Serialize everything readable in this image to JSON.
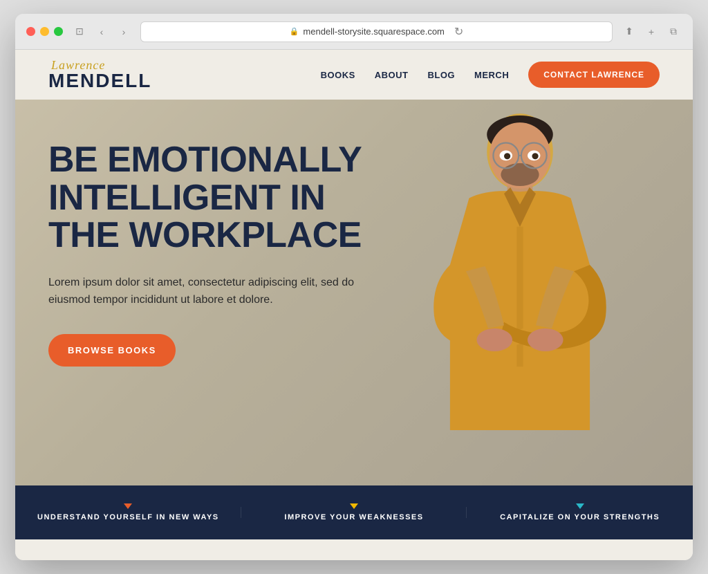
{
  "browser": {
    "url": "mendell-storysite.squarespace.com",
    "reload_icon": "↻",
    "back_icon": "‹",
    "forward_icon": "›",
    "share_icon": "⬆",
    "add_tab_icon": "+",
    "tabs_icon": "⧉",
    "window_icon": "⊡"
  },
  "navbar": {
    "logo_script": "Lawrence",
    "logo_main": "MENDELL",
    "nav_items": [
      {
        "label": "BOOKS",
        "id": "books"
      },
      {
        "label": "ABOUT",
        "id": "about"
      },
      {
        "label": "BLOG",
        "id": "blog"
      },
      {
        "label": "MERCH",
        "id": "merch"
      }
    ],
    "contact_button": "CONTACT LAWRENCE"
  },
  "hero": {
    "headline_line1": "BE EMOTIONALLY",
    "headline_line2": "INTELLIGENT IN",
    "headline_line3": "THE WORKPLACE",
    "subtext": "Lorem ipsum dolor sit amet, consectetur adipiscing elit, sed do eiusmod tempor incididunt ut labore et dolore.",
    "cta_button": "BROWSE BOOKS"
  },
  "bottom_bar": {
    "items": [
      {
        "label": "UNDERSTAND YOURSELF IN NEW WAYS",
        "arrow_color": "orange"
      },
      {
        "label": "IMPROVE YOUR WEAKNESSES",
        "arrow_color": "yellow"
      },
      {
        "label": "CAPITALIZE ON YOUR STRENGTHS",
        "arrow_color": "teal"
      }
    ]
  },
  "colors": {
    "brand_blue": "#1a2744",
    "brand_orange": "#e85d2a",
    "brand_gold": "#c8a020",
    "hero_bg": "#c8bfa8"
  }
}
